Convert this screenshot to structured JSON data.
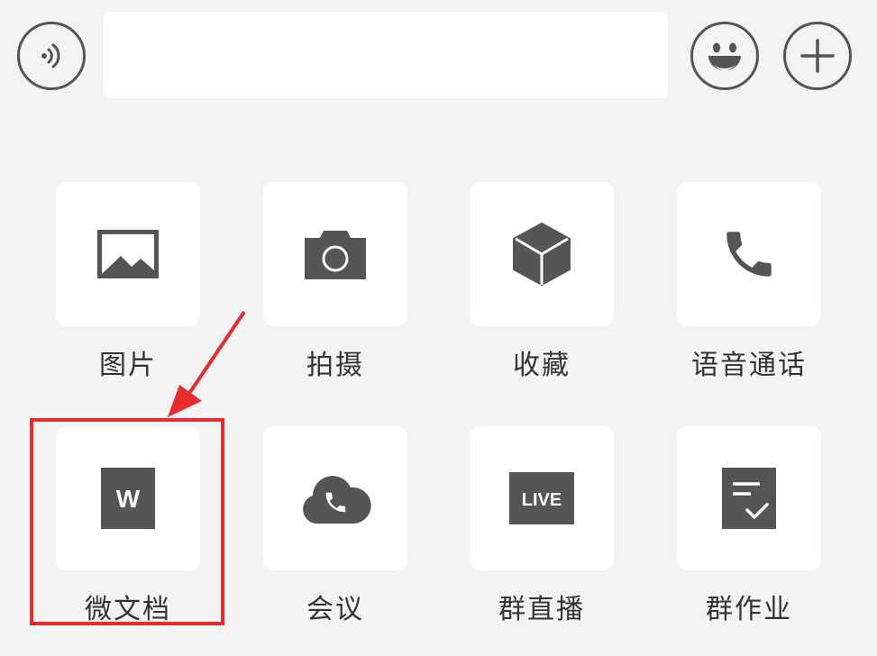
{
  "input": {
    "placeholder": "",
    "value": ""
  },
  "toolbar": {
    "voice_icon": "voice-icon",
    "emoji_icon": "emoji-icon",
    "plus_icon": "plus-icon"
  },
  "grid": [
    {
      "label": "图片",
      "icon": "image-icon"
    },
    {
      "label": "拍摄",
      "icon": "camera-icon"
    },
    {
      "label": "收藏",
      "icon": "cube-icon"
    },
    {
      "label": "语音通话",
      "icon": "phone-icon"
    },
    {
      "label": "微文档",
      "icon": "document-w-icon"
    },
    {
      "label": "会议",
      "icon": "cloud-phone-icon"
    },
    {
      "label": "群直播",
      "icon": "live-icon"
    },
    {
      "label": "群作业",
      "icon": "homework-icon"
    }
  ],
  "grid_icon_text": {
    "doc_letter": "W",
    "live_text": "LIVE"
  },
  "annotation": {
    "color": "#e52d2d"
  },
  "colors": {
    "background": "#f3f3f3",
    "tile": "#ffffff",
    "icon": "#555555",
    "label": "#333333"
  }
}
